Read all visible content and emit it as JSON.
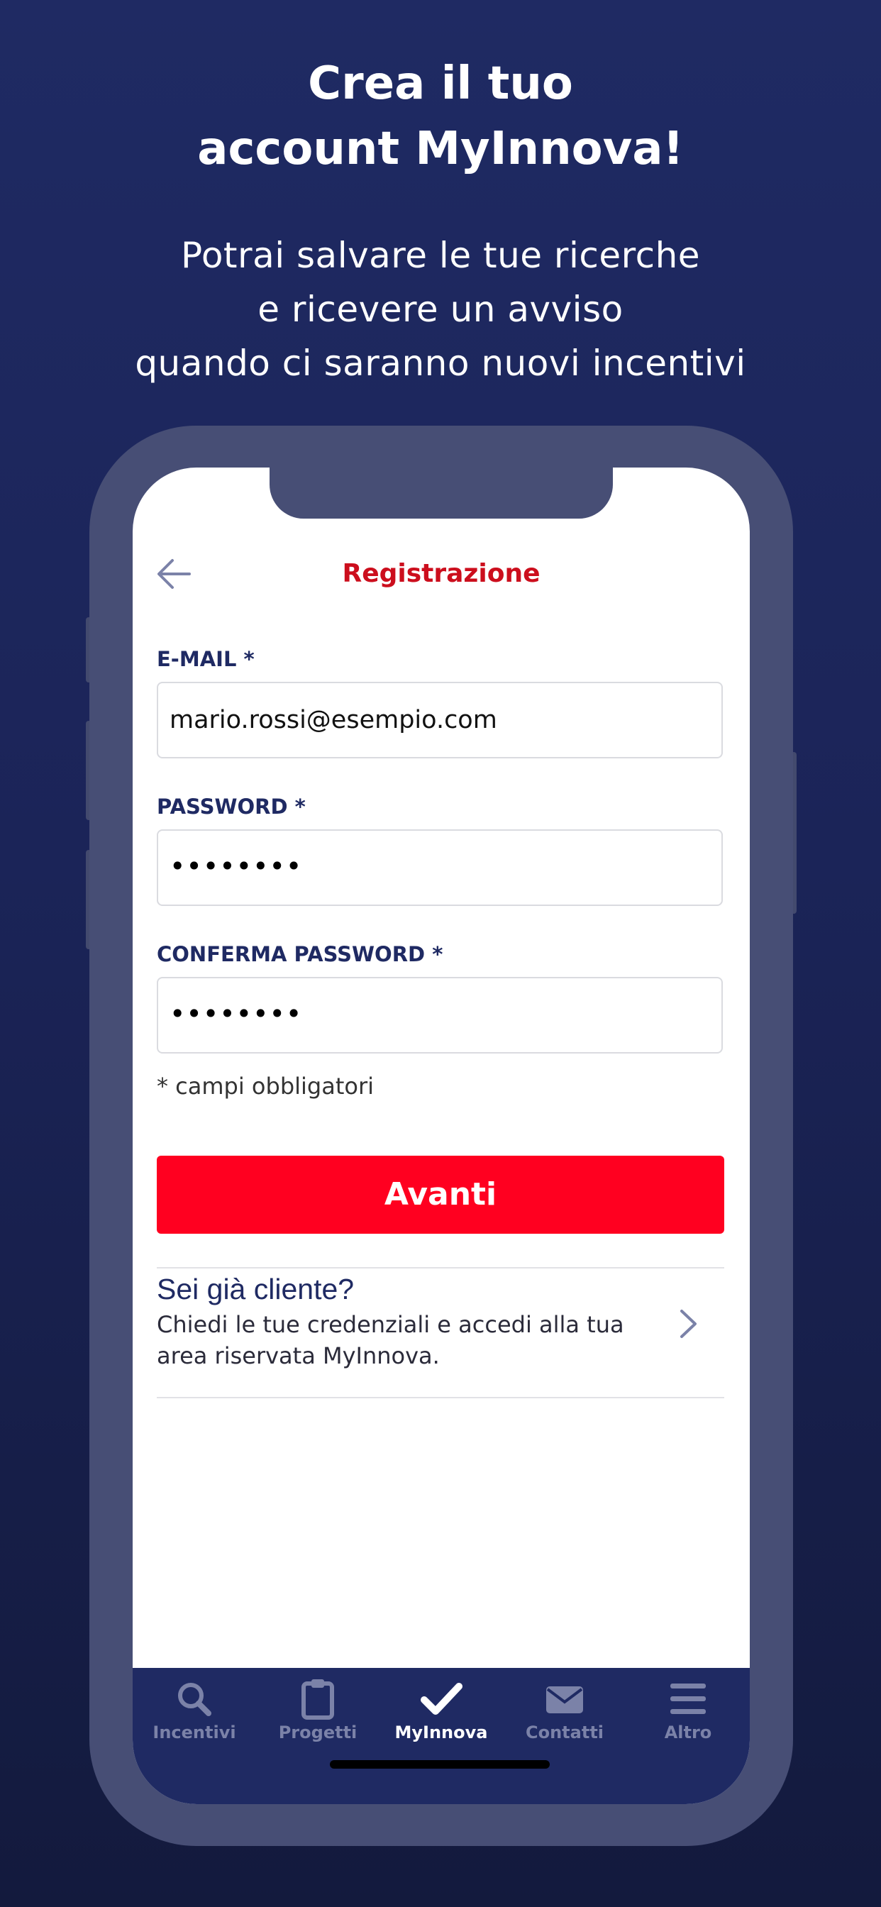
{
  "promo": {
    "title_line1": "Crea il tuo",
    "title_line2": "account MyInnova!",
    "subtitle_line1": "Potrai salvare le tue ricerche",
    "subtitle_line2": "e ricevere un avviso",
    "subtitle_line3": "quando ci saranno nuovi incentivi"
  },
  "screen": {
    "title": "Registrazione",
    "back_icon": "arrow-left-icon"
  },
  "form": {
    "email_label": "E-MAIL *",
    "email_value": "mario.rossi@esempio.com",
    "password_label": "PASSWORD *",
    "password_value": "••••••••",
    "confirm_label": "CONFERMA PASSWORD *",
    "confirm_value": "••••••••",
    "required_note": "* campi obbligatori",
    "next_button": "Avanti"
  },
  "client": {
    "title": "Sei già cliente?",
    "description": "Chiedi le tue credenziali e accedi alla tua area riservata MyInnova.",
    "icon": "chevron-right-icon"
  },
  "tabbar": {
    "tabs": [
      {
        "label": "Incentivi",
        "icon": "search-icon",
        "active": false
      },
      {
        "label": "Progetti",
        "icon": "clipboard-icon",
        "active": false
      },
      {
        "label": "MyInnova",
        "icon": "check-icon",
        "active": true
      },
      {
        "label": "Contatti",
        "icon": "envelope-icon",
        "active": false
      },
      {
        "label": "Altro",
        "icon": "menu-icon",
        "active": false
      }
    ]
  },
  "colors": {
    "background": "#1f2a63",
    "accent_red": "#ff0020",
    "title_red": "#cc0e1d",
    "navy": "#1f2a63",
    "tab_inactive": "#7b82a8"
  }
}
